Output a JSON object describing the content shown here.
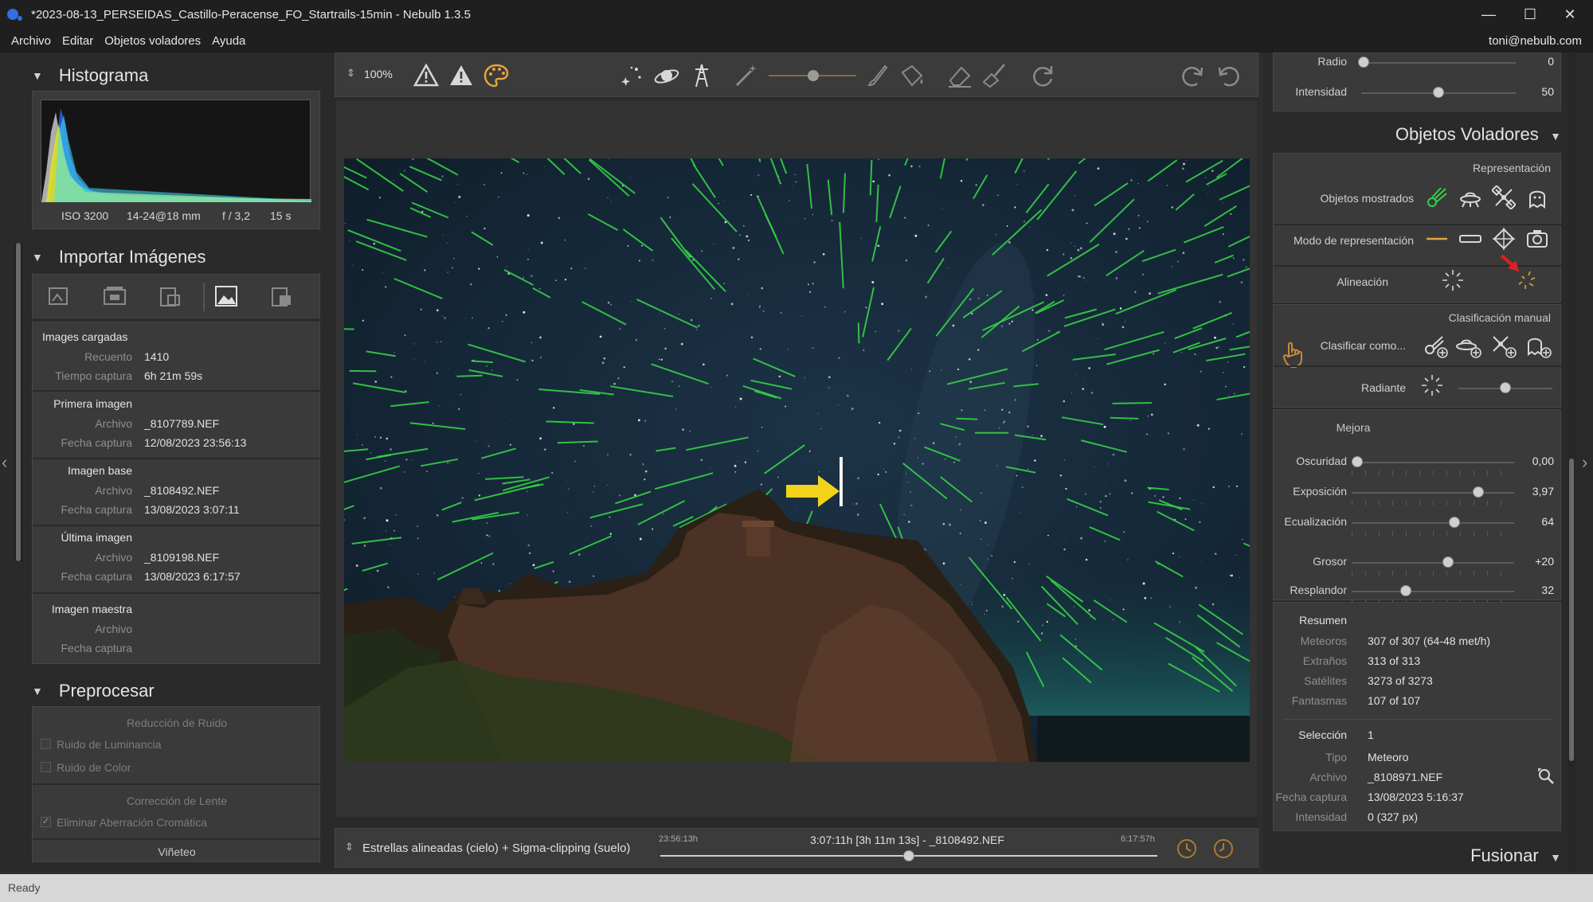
{
  "window": {
    "title": "*2023-08-13_PERSEIDAS_Castillo-Peracense_FO_Startrails-15min - Nebulb 1.3.5",
    "minimize": "—",
    "maximize": "☐",
    "close": "✕"
  },
  "menu": {
    "items": [
      "Archivo",
      "Editar",
      "Objetos voladores",
      "Ayuda"
    ],
    "user": "toni@nebulb.com"
  },
  "histogram": {
    "header": "Histograma",
    "iso": "ISO 3200",
    "lens": "14-24@18 mm",
    "aperture": "f / 3,2",
    "exposure": "15 s"
  },
  "import": {
    "header": "Importar Imágenes",
    "loaded": {
      "title": "Images cargadas",
      "count_label": "Recuento",
      "count_value": "1410",
      "time_label": "Tiempo captura",
      "time_value": "6h 21m 59s"
    },
    "first": {
      "title": "Primera imagen",
      "file_label": "Archivo",
      "file_value": "_8107789.NEF",
      "date_label": "Fecha captura",
      "date_value": "12/08/2023 23:56:13"
    },
    "base": {
      "title": "Imagen base",
      "file_label": "Archivo",
      "file_value": "_8108492.NEF",
      "date_label": "Fecha captura",
      "date_value": "13/08/2023 3:07:11"
    },
    "last": {
      "title": "Última imagen",
      "file_label": "Archivo",
      "file_value": "_8109198.NEF",
      "date_label": "Fecha captura",
      "date_value": "13/08/2023 6:17:57"
    },
    "master": {
      "title": "Imagen maestra",
      "file_label": "Archivo",
      "date_label": "Fecha captura"
    }
  },
  "preprocess": {
    "header": "Preprocesar",
    "noise_title": "Reducción de Ruido",
    "luminance": "Ruido de Luminancia",
    "color": "Ruido de Color",
    "lens_title": "Corrección de Lente",
    "chromatic": "Eliminar Aberración Cromática",
    "vignette": "Viñeteo"
  },
  "toolbar": {
    "zoom": "100%",
    "zoom_arrows": "⇕"
  },
  "timeline": {
    "mode": "Estrellas alineadas (cielo) + Sigma-clipping (suelo)",
    "start": "23:56:13h",
    "center": "3:07:11h [3h 11m 13s] - _8108492.NEF",
    "end": "6:17:57h",
    "position": 0.5
  },
  "right": {
    "radio_label": "Radio",
    "radio_value": "0",
    "intensidad_label": "Intensidad",
    "intensidad_value": "50",
    "intensidad_level": 0.5,
    "flying_header": "Objetos Voladores",
    "representacion": "Representación",
    "objetos_mostrados": "Objetos mostrados",
    "modo_representacion": "Modo de representación",
    "alineacion": "Alineación",
    "clasificacion_manual": "Clasificación manual",
    "clasificar_como": "Clasificar como...",
    "radiante": "Radiante",
    "radiante_level": 0.5,
    "mejora": "Mejora",
    "sliders": [
      {
        "label": "Oscuridad",
        "value": "0,00",
        "level": 0.0
      },
      {
        "label": "Exposición",
        "value": "3,97",
        "level": 0.8
      },
      {
        "label": "Ecualización",
        "value": "64",
        "level": 0.64
      },
      {
        "label": "Grosor",
        "value": "+20",
        "level": 0.6
      },
      {
        "label": "Resplandor",
        "value": "32",
        "level": 0.32
      }
    ],
    "resumen": {
      "title": "Resumen",
      "rows": [
        {
          "label": "Meteoros",
          "value": "307 of 307 (64-48 met/h)"
        },
        {
          "label": "Extraños",
          "value": "313 of 313"
        },
        {
          "label": "Satélites",
          "value": "3273 of 3273"
        },
        {
          "label": "Fantasmas",
          "value": "107 of 107"
        }
      ]
    },
    "seleccion": {
      "title": "Selección",
      "value": "1",
      "rows": [
        {
          "label": "Tipo",
          "value": "Meteoro"
        },
        {
          "label": "Archivo",
          "value": "_8108971.NEF"
        },
        {
          "label": "Fecha captura",
          "value": "13/08/2023 5:16:37"
        },
        {
          "label": "Intensidad",
          "value": "0 (327 px)"
        }
      ]
    },
    "fusionar": "Fusionar"
  },
  "status": "Ready",
  "colors": {
    "accent_orange": "#e8a33c",
    "meteor_green": "#35d045",
    "arrow_yellow": "#f3d21a",
    "arrow_red": "#e02020"
  }
}
